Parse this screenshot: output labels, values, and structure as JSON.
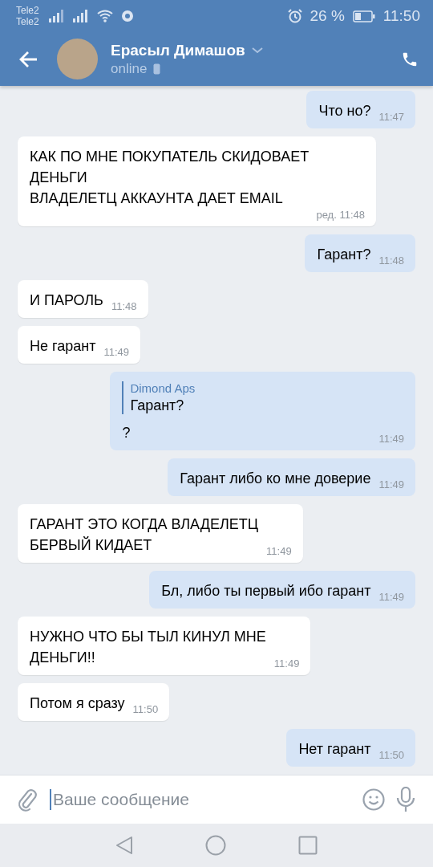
{
  "status_bar": {
    "carriers": [
      "Tele2",
      "Tele2"
    ],
    "battery_text": "26 %",
    "time": "11:50"
  },
  "header": {
    "name": "Ерасыл Димашов",
    "status": "online"
  },
  "messages": [
    {
      "kind": "out",
      "text": "Что но?",
      "time": "11:47"
    },
    {
      "kind": "in",
      "text": "КАК ПО МНЕ ПОКУПАТЕЛЬ СКИДОВАЕТ ДЕНЬГИ\nВЛАДЕЛЕТЦ АККАУНТА ДАЕТ EMAIL",
      "time": "ред. 11:48"
    },
    {
      "kind": "out",
      "text": "Гарант?",
      "time": "11:48"
    },
    {
      "kind": "in",
      "text": "И ПАРОЛЬ",
      "time": "11:48"
    },
    {
      "kind": "in",
      "text": "Не гарант",
      "time": "11:49"
    },
    {
      "kind": "out",
      "reply": {
        "author": "Dimond Aps",
        "text": "Гарант?"
      },
      "text": "?",
      "time": "11:49"
    },
    {
      "kind": "out",
      "text": "Гарант либо ко мне доверие",
      "time": "11:49"
    },
    {
      "kind": "in",
      "text": "ГАРАНТ ЭТО КОГДА ВЛАДЕЛЕТЦ\nБЕРВЫЙ КИДАЕТ",
      "time": "11:49"
    },
    {
      "kind": "out",
      "text": "Бл, либо ты первый ибо гарант",
      "time": "11:49"
    },
    {
      "kind": "in",
      "text": "НУЖНО ЧТО БЫ ТЫЛ КИНУЛ МНЕ\nДЕНЬГИ!!",
      "time": "11:49"
    },
    {
      "kind": "in",
      "text": "Потом я сразу",
      "time": "11:50"
    },
    {
      "kind": "out",
      "text": "Нет гарант",
      "time": "11:50"
    }
  ],
  "composer": {
    "placeholder": "Ваше сообщение"
  }
}
